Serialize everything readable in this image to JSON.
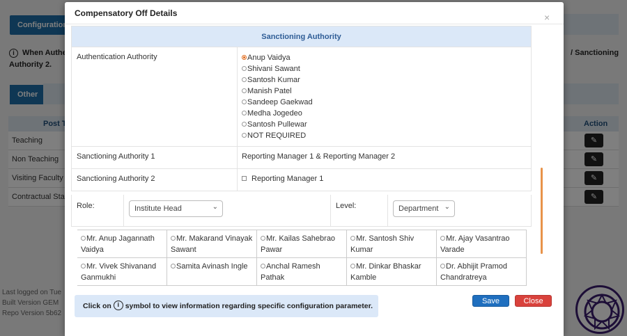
{
  "background": {
    "tab_configuration": "Configuration",
    "note_left": "When Authe",
    "note_line2": "Authority 2.",
    "note_right": "/ Sanctioning",
    "tab_other": "Other",
    "table_head_post": "Post T",
    "table_head_action": "Action",
    "rows": [
      "Teaching",
      "Non Teaching",
      "Visiting Faculty",
      "Contractual Staff"
    ],
    "footer_lines": [
      "Last logged on Tue",
      "Built Version GEM",
      "Repo Version 5b62"
    ]
  },
  "modal": {
    "title": "Compensatory Off Details",
    "close_symbol": "×",
    "section_title": "Sanctioning Authority",
    "authentication": {
      "label": "Authentication Authority",
      "options": [
        "Anup Vaidya",
        "Shivani Sawant",
        "Santosh Kumar",
        "Manish Patel",
        "Sandeep Gaekwad",
        "Medha Jogedeo",
        "Santosh Pullewar",
        "NOT REQUIRED"
      ],
      "selected": "Anup Vaidya"
    },
    "sanctioning_1": {
      "label": "Sanctioning Authority 1",
      "value": "Reporting Manager 1 & Reporting Manager 2"
    },
    "sanctioning_2": {
      "label": "Sanctioning Authority 2",
      "checkbox_label": "Reporting Manager 1"
    },
    "filters": {
      "role_label": "Role:",
      "role_value": "Institute Head",
      "level_label": "Level:",
      "level_value": "Department"
    },
    "people": [
      {
        "line1": "Mr. Anup Jagannath",
        "line2": "Vaidya"
      },
      {
        "line1": "Mr. Makarand Vinayak",
        "line2": "Sawant"
      },
      {
        "line1": "Mr. Kailas Sahebrao",
        "line2": "Pawar"
      },
      {
        "line1": "Mr. Santosh Shiv Kumar",
        "line2": ""
      },
      {
        "line1": "Mr. Ajay Vasantrao",
        "line2": "Varade"
      },
      {
        "line1": "Mr. Vivek Shivanand",
        "line2": "Ganmukhi"
      },
      {
        "line1": "Samita Avinash Ingle",
        "line2": ""
      },
      {
        "line1": "Anchal Ramesh Pathak",
        "line2": ""
      },
      {
        "line1": "Mr. Dinkar Bhaskar",
        "line2": "Kamble"
      },
      {
        "line1": "Dr. Abhijit Pramod",
        "line2": "Chandratreya"
      }
    ],
    "info": {
      "prefix": "Click on",
      "icon_glyph": "i",
      "suffix": "symbol to view information regarding specific configuration parameter."
    },
    "save_label": "Save",
    "close_label": "Close"
  },
  "colors": {
    "primary": "#1f6fbf",
    "danger": "#d9423c",
    "section_bg": "#dbe8f8",
    "accent": "#e06a1c"
  }
}
